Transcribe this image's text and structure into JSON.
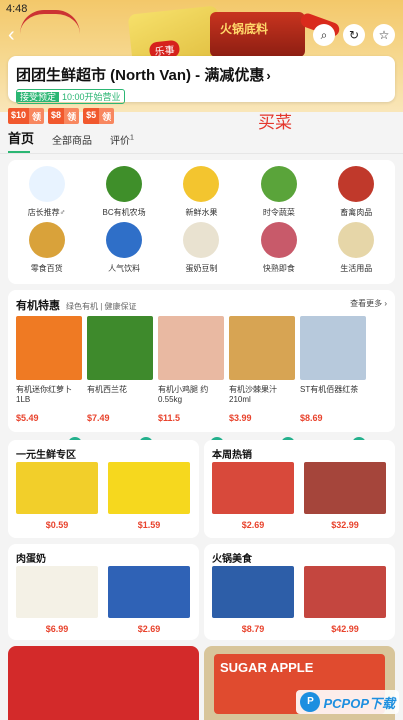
{
  "status_bar": {
    "time": "4:48"
  },
  "banner": {
    "chips_brand": "乐事",
    "hotpot_brand": "火锅底料"
  },
  "store": {
    "name": "团团生鲜超市 (North Van) - 满减优惠",
    "arrow": "›",
    "tag": "接受预定",
    "hours": "10:00开始营业"
  },
  "coupons": [
    {
      "amount": "$10",
      "action": "领"
    },
    {
      "amount": "$8",
      "action": "领"
    },
    {
      "amount": "$5",
      "action": "领"
    }
  ],
  "watermark_text": "买菜",
  "tabs": [
    {
      "label": "首页"
    },
    {
      "label": "全部商品"
    },
    {
      "label": "评价",
      "badge": "1"
    }
  ],
  "categories": [
    {
      "label": "店长推荐♂",
      "icon": "chef-icon",
      "color": "#e8f3ff"
    },
    {
      "label": "BC有机农场",
      "icon": "broccoli-icon",
      "color": "#3f8f2a"
    },
    {
      "label": "新鲜水果",
      "icon": "banana-icon",
      "color": "#f3c52f"
    },
    {
      "label": "时令蔬菜",
      "icon": "vegetables-icon",
      "color": "#5aa43a"
    },
    {
      "label": "畜禽肉品",
      "icon": "steak-icon",
      "color": "#c0392b"
    },
    {
      "label": "零食百货",
      "icon": "snacks-icon",
      "color": "#d9a23a"
    },
    {
      "label": "人气饮料",
      "icon": "drink-can-icon",
      "color": "#2f6fc8"
    },
    {
      "label": "蛋奶豆制",
      "icon": "milk-icon",
      "color": "#e9e2d0"
    },
    {
      "label": "快熟即食",
      "icon": "instant-food-icon",
      "color": "#c85a6a"
    },
    {
      "label": "生活用品",
      "icon": "bottle-icon",
      "color": "#e6d6a8"
    }
  ],
  "organic": {
    "title": "有机特惠",
    "subtitle": "绿色有机 | 健康保证",
    "more": "查看更多 ›",
    "items": [
      {
        "name": "有机迷你红萝卜 1LB",
        "price": "$5.49",
        "color": "#ef7a23"
      },
      {
        "name": "有机西兰花",
        "price": "$7.49",
        "color": "#3e8a2c"
      },
      {
        "name": "有机小鸡腿 约0.55kg",
        "price": "$11.5",
        "color": "#e9b9a2"
      },
      {
        "name": "有机沙棘果汁 210ml",
        "price": "$3.99",
        "color": "#d7a453"
      },
      {
        "name": "ST有机佰器红茶",
        "price": "$8.69",
        "color": "#b7c9dc"
      }
    ]
  },
  "one_dollar": {
    "title": "一元生鲜专区",
    "items": [
      {
        "price": "$0.59",
        "color": "#f2cf2a"
      },
      {
        "price": "$1.59",
        "color": "#f6d81e"
      }
    ]
  },
  "weekly_hot": {
    "title": "本周热销",
    "items": [
      {
        "price": "$2.69",
        "color": "#d8493b"
      },
      {
        "price": "$32.99",
        "color": "#a5453b"
      }
    ]
  },
  "meat_egg_milk": {
    "title": "肉蛋奶",
    "items": [
      {
        "price": "$6.99",
        "color": "#f4f1e6"
      },
      {
        "price": "$2.69",
        "color": "#2f62b6"
      }
    ]
  },
  "hotpot": {
    "title": "火锅美食",
    "items": [
      {
        "price": "$8.79",
        "color": "#2d5ea8"
      },
      {
        "price": "$42.99",
        "color": "#c4463f"
      }
    ]
  },
  "bottom": {
    "left_color": "#d32a2a",
    "right_label": "SUGAR APPLE",
    "right_color": "#e04b2f"
  },
  "pcpop": {
    "text": "PCPOP下载"
  }
}
